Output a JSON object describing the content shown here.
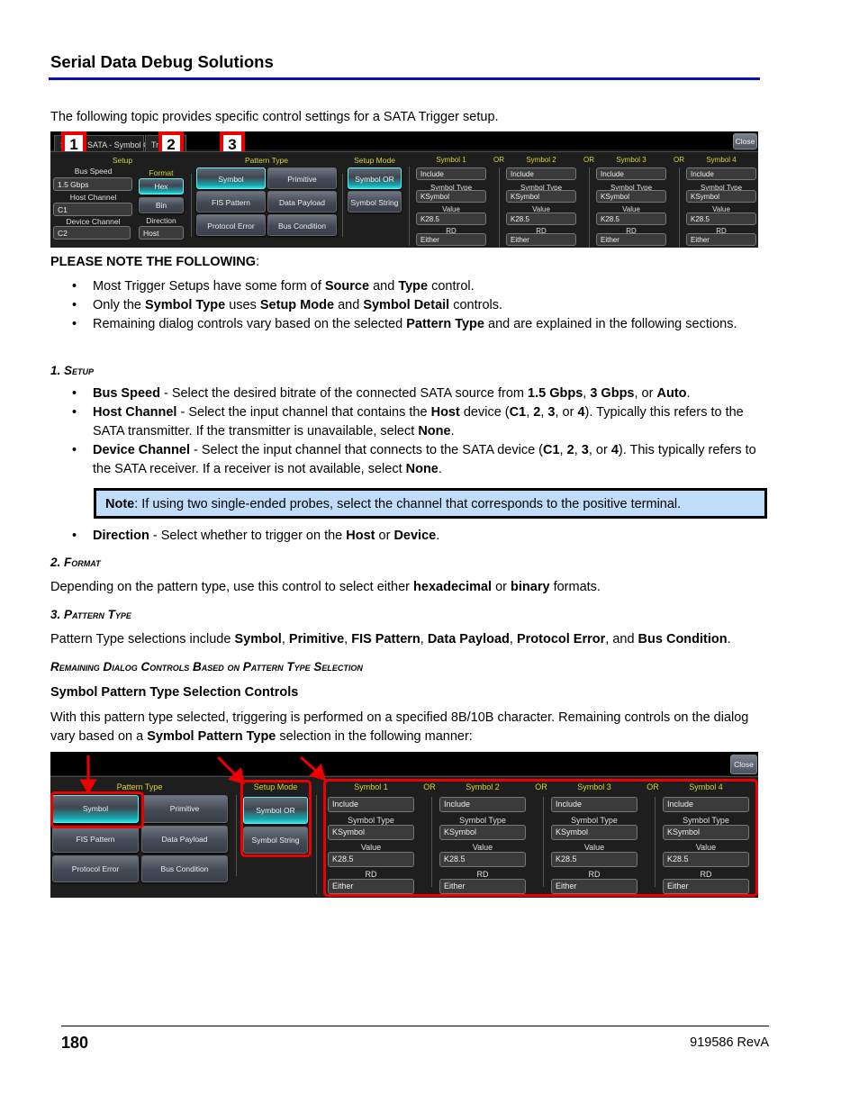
{
  "header": {
    "title": "Serial Data Debug Solutions"
  },
  "intro": "The following topic provides specific control settings for a SATA Trigger setup.",
  "shot1": {
    "tabs": [
      "S",
      "SATA - Symbol OR",
      "Tri"
    ],
    "callouts": [
      "1",
      "2",
      "3"
    ],
    "close_label": "Close",
    "setup": {
      "heading": "Setup",
      "bus_speed_label": "Bus Speed",
      "bus_speed_value": "1.5 Gbps",
      "host_channel_label": "Host Channel",
      "host_channel_value": "C1",
      "device_channel_label": "Device Channel",
      "device_channel_value": "C2"
    },
    "format": {
      "heading": "Format",
      "hex": "Hex",
      "bin": "Bin",
      "direction_label": "Direction",
      "direction_value": "Host"
    },
    "pattern_type": {
      "heading": "Pattern Type",
      "buttons": [
        "Symbol",
        "Primitive",
        "FIS Pattern",
        "Data Payload",
        "Protocol Error",
        "Bus Condition"
      ],
      "selected": "Symbol"
    },
    "setup_mode": {
      "heading": "Setup Mode",
      "buttons": [
        "Symbol OR",
        "Symbol String"
      ],
      "selected": "Symbol OR"
    },
    "or_label": "OR",
    "symbols": [
      {
        "heading": "Symbol 1",
        "include": "Include",
        "type_label": "Symbol Type",
        "type_value": "KSymbol",
        "value_label": "Value",
        "value": "K28.5",
        "rd_label": "RD",
        "rd_value": "Either"
      },
      {
        "heading": "Symbol 2",
        "include": "Include",
        "type_label": "Symbol Type",
        "type_value": "KSymbol",
        "value_label": "Value",
        "value": "K28.5",
        "rd_label": "RD",
        "rd_value": "Either"
      },
      {
        "heading": "Symbol 3",
        "include": "Include",
        "type_label": "Symbol Type",
        "type_value": "KSymbol",
        "value_label": "Value",
        "value": "K28.5",
        "rd_label": "RD",
        "rd_value": "Either"
      },
      {
        "heading": "Symbol 4",
        "include": "Include",
        "type_label": "Symbol Type",
        "type_value": "KSymbol",
        "value_label": "Value",
        "value": "K28.5",
        "rd_label": "RD",
        "rd_value": "Either"
      }
    ]
  },
  "notes": {
    "heading": "PLEASE NOTE THE FOLLOWING",
    "items": [
      [
        "Most Trigger Setups have some form of ",
        "Source",
        " and ",
        "Type",
        " control."
      ],
      [
        "Only the ",
        "Symbol Type",
        " uses ",
        "Setup Mode",
        " and ",
        "Symbol Detail",
        " controls."
      ],
      [
        "Remaining dialog controls vary based on the selected ",
        "Pattern Type",
        " and are explained in the following sections."
      ]
    ]
  },
  "sections": {
    "setup": {
      "heading": "1. Setup",
      "bus_speed": [
        "Bus Speed",
        " - Select the desired bitrate of the connected SATA source from ",
        "1.5 Gbps",
        ", ",
        "3 Gbps",
        ", or ",
        "Auto",
        "."
      ],
      "host_channel": [
        "Host Channel",
        " - Select the input channel that contains the ",
        "Host",
        " device (",
        "C1",
        ", ",
        "2",
        ", ",
        "3",
        ", or ",
        "4",
        "). Typically this refers to the SATA transmitter. If the transmitter is unavailable, select ",
        "None",
        "."
      ],
      "device_channel": [
        "Device Channel",
        " - Select the input channel that connects to the SATA device (",
        "C1",
        ", ",
        "2",
        ", ",
        "3",
        ", or ",
        "4",
        "). This typically refers to the SATA receiver. If a receiver is not available, select ",
        "None",
        "."
      ],
      "note": [
        "Note",
        ": If using two single-ended probes, select the channel that corresponds to the positive terminal."
      ],
      "direction": [
        "Direction",
        " - Select whether to trigger on the ",
        "Host",
        " or ",
        "Device",
        "."
      ]
    },
    "format": {
      "heading": "2. Format",
      "text": [
        "Depending on the pattern type, use this control to select either ",
        "hexadecimal",
        " or ",
        "binary",
        " formats."
      ]
    },
    "pattern_type": {
      "heading": "3. Pattern Type",
      "text": [
        "Pattern Type selections include ",
        "Symbol",
        ", ",
        "Primitive",
        ", ",
        "FIS Pattern",
        ", ",
        "Data Payload",
        ", ",
        "Protocol Error",
        ", and ",
        "Bus Condition",
        "."
      ]
    },
    "remaining": {
      "heading": "Remaining Dialog Controls Based on Pattern Type Selection",
      "sub_heading": "Symbol Pattern Type Selection Controls",
      "text": [
        "With this pattern type selected, triggering is performed on a specified 8B/10B character. Remaining controls on the dialog vary based on a ",
        "Symbol Pattern Type",
        " selection in the following manner:"
      ]
    }
  },
  "footer": {
    "page_number": "180",
    "revision": "919586 RevA"
  }
}
